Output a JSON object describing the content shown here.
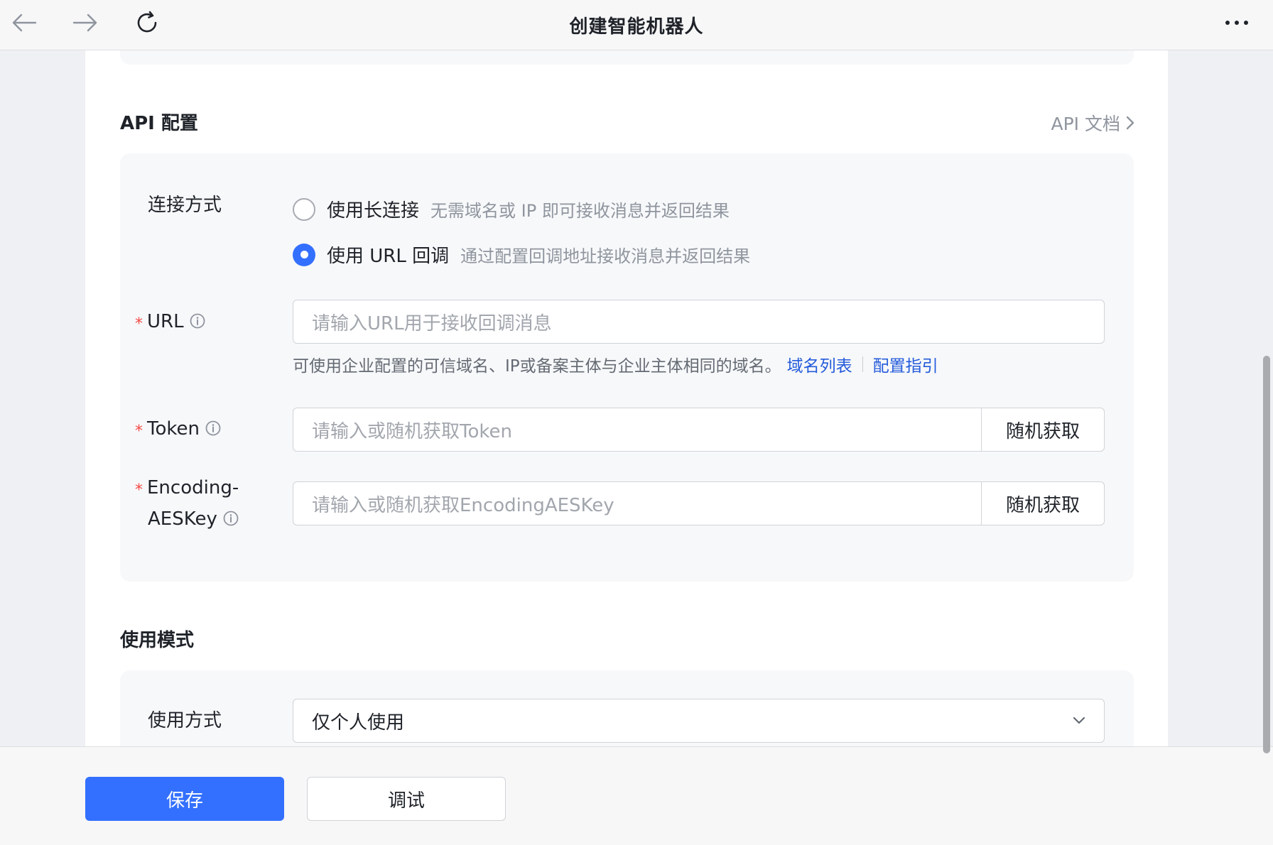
{
  "header": {
    "title": "创建智能机器人"
  },
  "api_section": {
    "title": "API 配置",
    "doc_link": "API 文档"
  },
  "connection": {
    "label": "连接方式",
    "options": [
      {
        "label": "使用长连接",
        "desc": "无需域名或 IP 即可接收消息并返回结果",
        "checked": false
      },
      {
        "label": "使用 URL 回调",
        "desc": "通过配置回调地址接收消息并返回结果",
        "checked": true
      }
    ]
  },
  "url_field": {
    "required_mark": "*",
    "label": "URL",
    "placeholder": "请输入URL用于接收回调消息",
    "hint": "可使用企业配置的可信域名、IP或备案主体与企业主体相同的域名。",
    "links": [
      "域名列表",
      "配置指引"
    ]
  },
  "token_field": {
    "required_mark": "*",
    "label": "Token",
    "placeholder": "请输入或随机获取Token",
    "button": "随机获取"
  },
  "aeskey_field": {
    "required_mark": "*",
    "label_line1": "Encoding-",
    "label_line2": "AESKey",
    "placeholder": "请输入或随机获取EncodingAESKey",
    "button": "随机获取"
  },
  "usage_section": {
    "title": "使用模式",
    "label": "使用方式",
    "selected": "仅个人使用"
  },
  "footer": {
    "save": "保存",
    "debug": "调试"
  },
  "colors": {
    "primary": "#3370ff",
    "link": "#245bdb",
    "required": "#f54a45"
  }
}
